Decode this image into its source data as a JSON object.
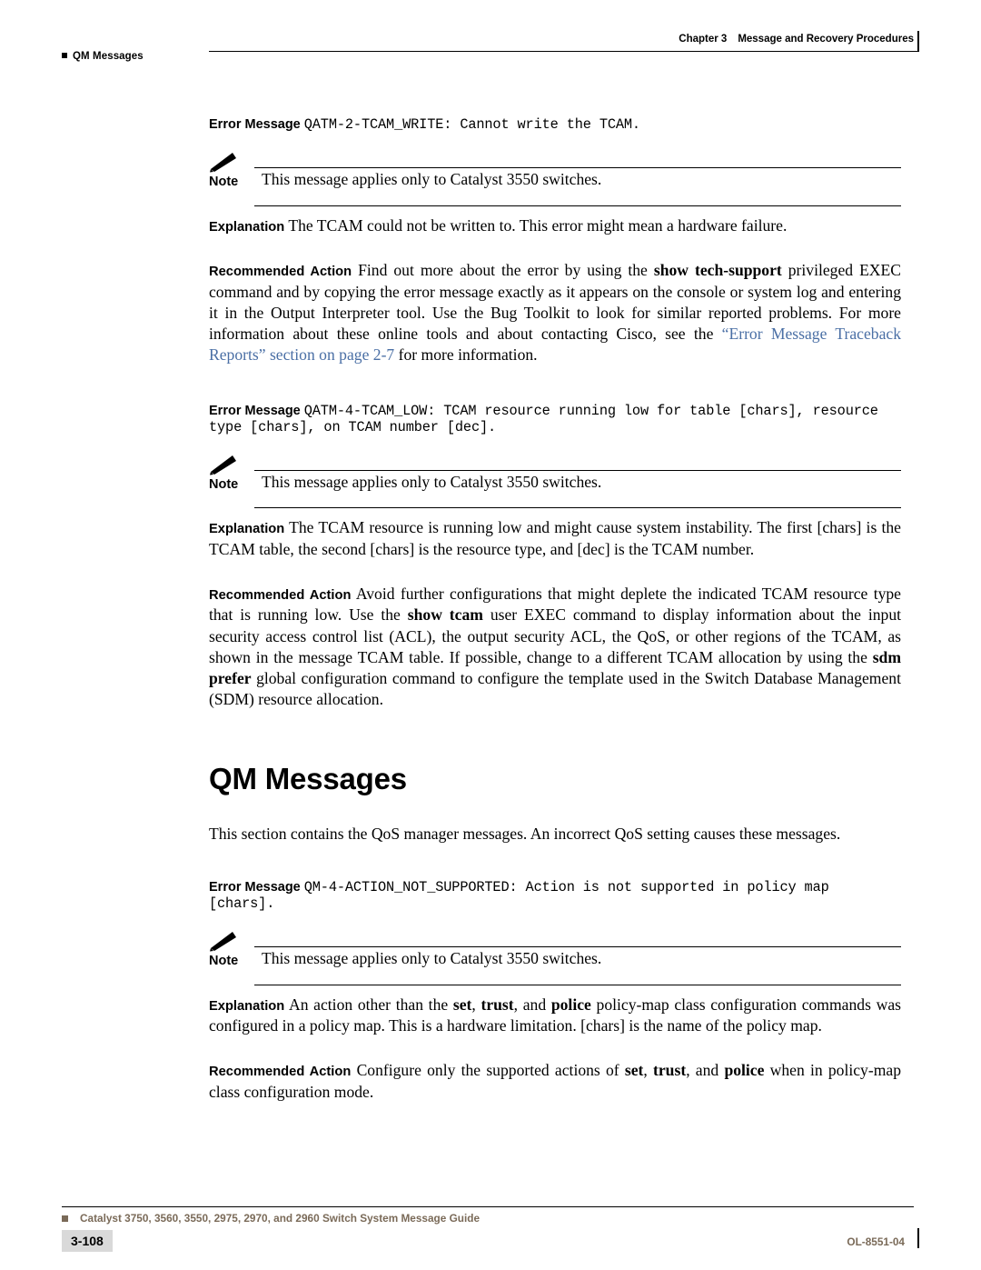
{
  "header": {
    "left_text": "QM Messages",
    "chapter": "Chapter 3",
    "chapter_title": "Message and Recovery Procedures"
  },
  "messages": [
    {
      "label": "Error Message",
      "text": "QATM-2-TCAM_WRITE: Cannot write the TCAM.",
      "note_label": "Note",
      "note_text": "This message applies only to Catalyst 3550 switches.",
      "explanation_label": "Explanation",
      "explanation_text": "The TCAM could not be written to. This error might mean a hardware failure.",
      "action_label": "Recommended Action",
      "action_part1": "Find out more about the error by using the ",
      "action_bold1": "show tech-support",
      "action_part2": " privileged EXEC command and by copying the error message exactly as it appears on the console or system log and entering it in the Output Interpreter tool. Use the Bug Toolkit to look for similar reported problems. For more information about these online tools and about contacting Cisco, see the ",
      "action_link": "“Error Message Traceback Reports” section on page 2-7",
      "action_part3": " for more information."
    },
    {
      "label": "Error Message",
      "text": "QATM-4-TCAM_LOW: TCAM resource running low for table [chars], resource type [chars], on TCAM number [dec].",
      "note_label": "Note",
      "note_text": "This message applies only to Catalyst 3550 switches.",
      "explanation_label": "Explanation",
      "explanation_text": "The TCAM resource is running low and might cause system instability. The first [chars] is the TCAM table, the second [chars] is the resource type, and [dec] is the TCAM number.",
      "action_label": "Recommended Action",
      "action_part1": "Avoid further configurations that might deplete the indicated TCAM resource type that is running low. Use the ",
      "action_bold1": "show tcam",
      "action_part2": " user EXEC command to display information about the input security access control list (ACL), the output security ACL, the QoS, or other regions of the TCAM, as shown in the message TCAM table. If possible, change to a different TCAM allocation by using the ",
      "action_bold2": "sdm prefer",
      "action_part3": " global configuration command to configure the template used in the Switch Database Management (SDM) resource allocation."
    }
  ],
  "section": {
    "title": "QM Messages",
    "intro": "This section contains the QoS manager messages. An incorrect QoS setting causes these messages."
  },
  "qm_message": {
    "label": "Error Message",
    "text": "QM-4-ACTION_NOT_SUPPORTED: Action is not supported in policy map [chars].",
    "note_label": "Note",
    "note_text": "This message applies only to Catalyst 3550 switches.",
    "explanation_label": "Explanation",
    "explanation_part1": "An action other than the ",
    "explanation_bold1": "set",
    "explanation_sep1": ", ",
    "explanation_bold2": "trust",
    "explanation_sep2": ", and ",
    "explanation_bold3": "police",
    "explanation_part2": " policy-map class configuration commands was configured in a policy map. This is a hardware limitation. [chars] is the name of the policy map.",
    "action_label": "Recommended Action",
    "action_part1": "Configure only the supported actions of ",
    "action_bold1": "set",
    "action_sep1": ", ",
    "action_bold2": "trust",
    "action_sep2": ", and ",
    "action_bold3": "police",
    "action_part2": " when in policy-map class configuration mode."
  },
  "footer": {
    "title": "Catalyst 3750, 3560, 3550, 2975, 2970, and 2960 Switch System Message Guide",
    "page": "3-108",
    "doc_number": "OL-8551-04"
  }
}
